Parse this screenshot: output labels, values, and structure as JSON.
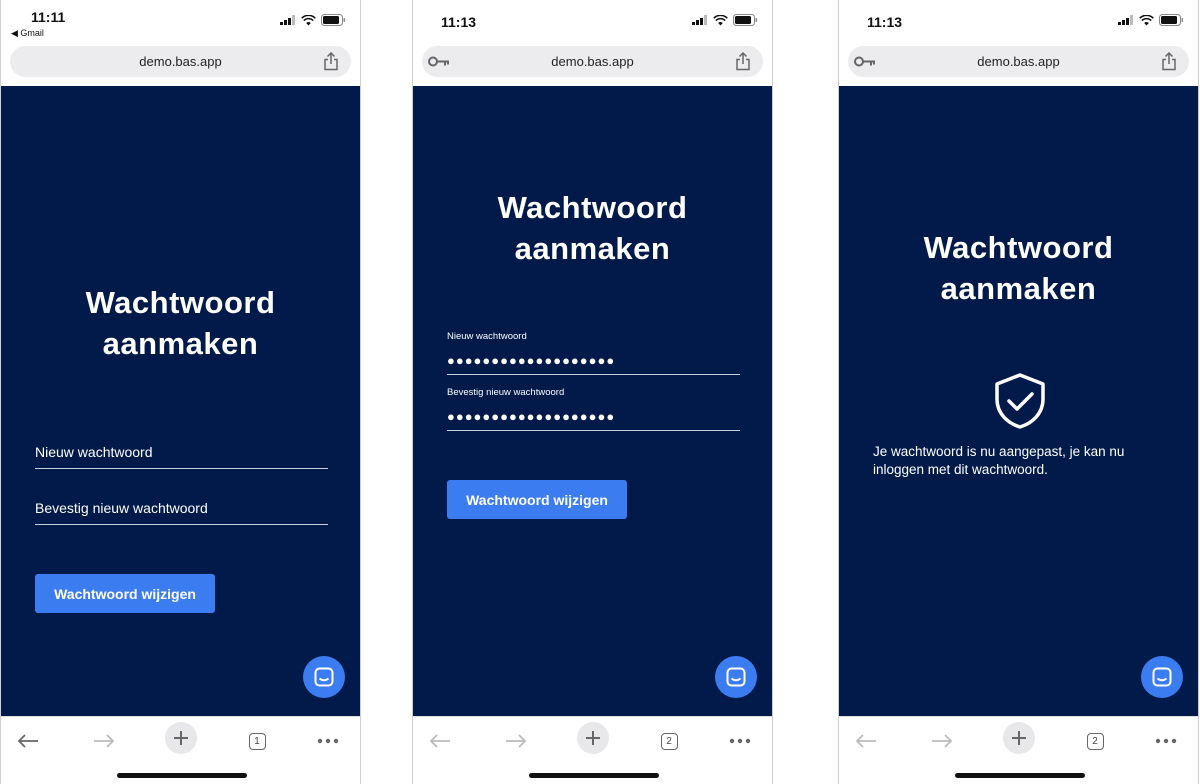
{
  "screens": [
    {
      "time": "11:11",
      "back_app": "◀ Gmail",
      "url": "demo.bas.app",
      "title_line1": "Wachtwoord",
      "title_line2": "aanmaken",
      "new_password_label": "Nieuw wachtwoord",
      "confirm_password_label": "Bevestig nieuw wachtwoord",
      "button_label": "Wachtwoord wijzigen",
      "tab_count": "1"
    },
    {
      "time": "11:13",
      "url": "demo.bas.app",
      "title_line1": "Wachtwoord",
      "title_line2": "aanmaken",
      "new_password_label": "Nieuw wachtwoord",
      "new_password_value": "●●●●●●●●●●●●●●●●●●●",
      "confirm_password_label": "Bevestig nieuw wachtwoord",
      "confirm_password_value": "●●●●●●●●●●●●●●●●●●●",
      "button_label": "Wachtwoord wijzigen",
      "tab_count": "2"
    },
    {
      "time": "11:13",
      "url": "demo.bas.app",
      "title_line1": "Wachtwoord",
      "title_line2": "aanmaken",
      "success_message": "Je wachtwoord is nu aangepast, je kan nu inloggen met dit wachtwoord.",
      "tab_count": "2"
    }
  ],
  "colors": {
    "app_background": "#021a4a",
    "accent": "#3b7df0"
  },
  "icons": [
    "signal-icon",
    "wifi-icon",
    "battery-icon",
    "key-icon",
    "share-icon",
    "chat-icon",
    "shield-check-icon",
    "back-arrow-icon",
    "forward-arrow-icon",
    "plus-icon",
    "tabs-icon",
    "more-icon"
  ]
}
